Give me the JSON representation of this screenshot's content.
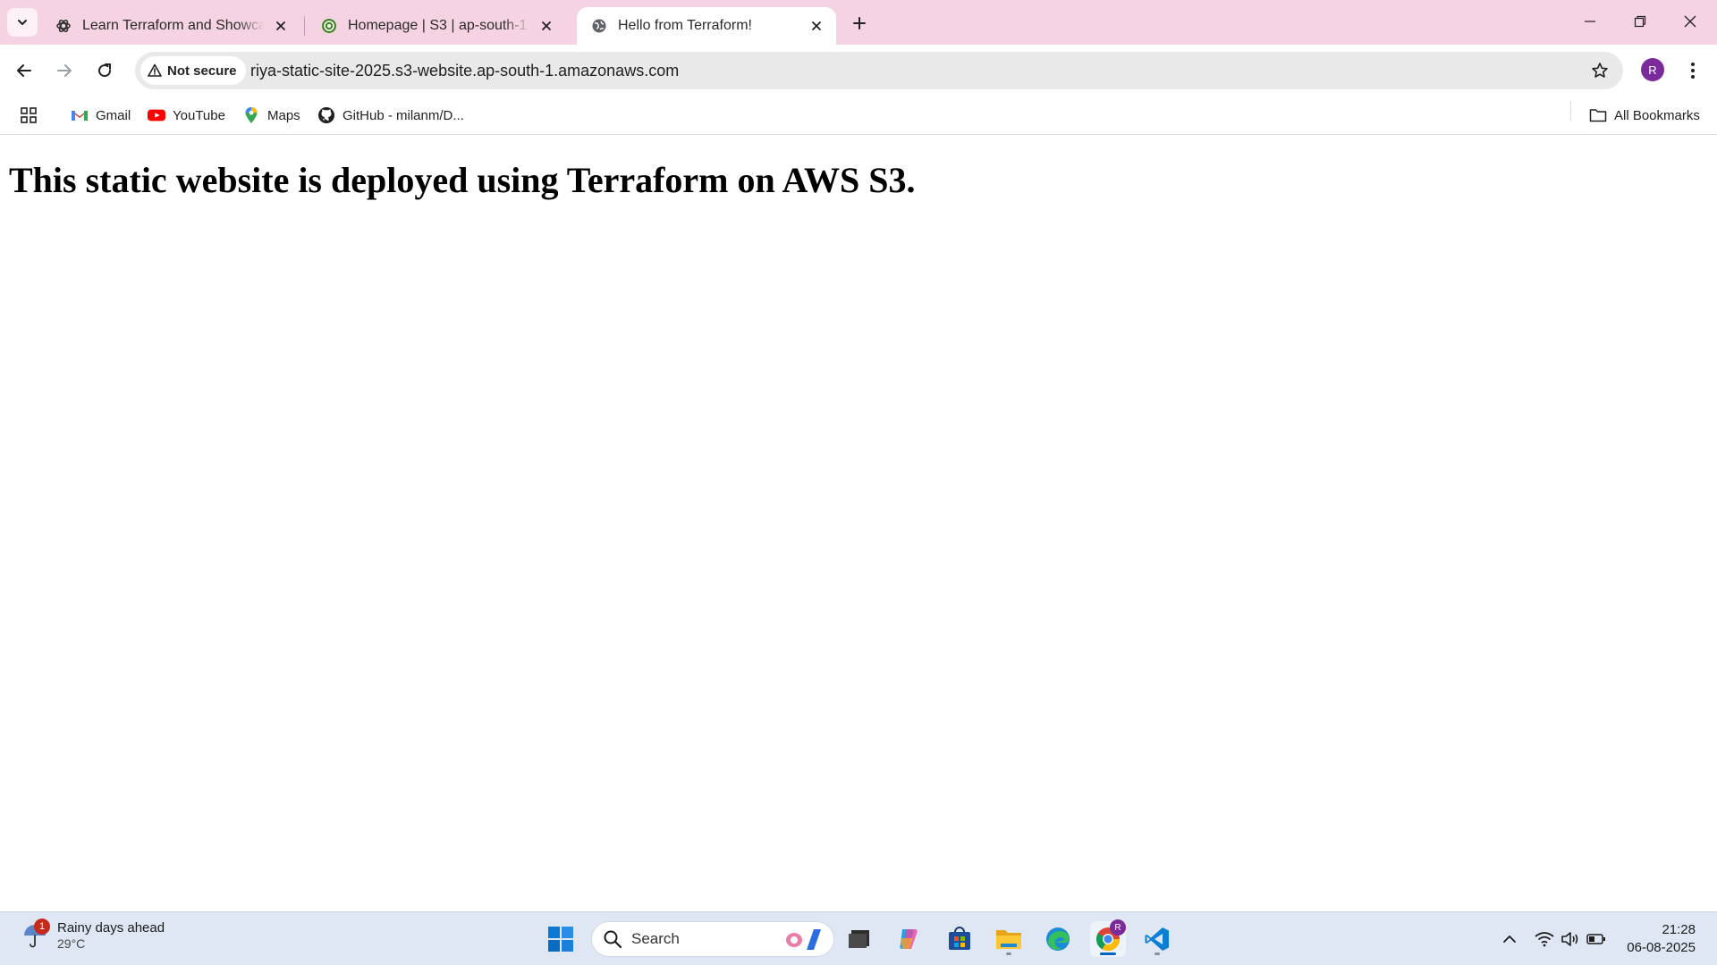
{
  "browser": {
    "tabs": [
      {
        "title": "Learn Terraform and Showcase Skills",
        "active": false,
        "favicon": "openai-icon"
      },
      {
        "title": "Homepage | S3 | ap-south-1",
        "active": false,
        "favicon": "aws-s3-icon"
      },
      {
        "title": "Hello from Terraform!",
        "active": true,
        "favicon": "globe-icon"
      }
    ],
    "address_bar": {
      "security_label": "Not secure",
      "url": "riya-static-site-2025.s3-website.ap-south-1.amazonaws.com"
    },
    "profile_initial": "R",
    "bookmarks": [
      {
        "label": "Gmail",
        "icon": "gmail-icon"
      },
      {
        "label": "YouTube",
        "icon": "youtube-icon"
      },
      {
        "label": "Maps",
        "icon": "maps-icon"
      },
      {
        "label": "GitHub - milanm/D...",
        "icon": "github-icon"
      }
    ],
    "all_bookmarks_label": "All Bookmarks"
  },
  "page": {
    "heading": "This static website is deployed using Terraform on AWS S3."
  },
  "taskbar": {
    "weather": {
      "summary": "Rainy days ahead",
      "temperature": "29°C",
      "badge_count": "1"
    },
    "search_placeholder": "Search",
    "chrome_badge": "R",
    "clock": {
      "time": "21:28",
      "date": "06-08-2025"
    }
  },
  "colors": {
    "tabstrip_bg": "#f6d3e2",
    "taskbar_bg": "#dfe7f4",
    "profile_avatar": "#7b2a9c"
  }
}
